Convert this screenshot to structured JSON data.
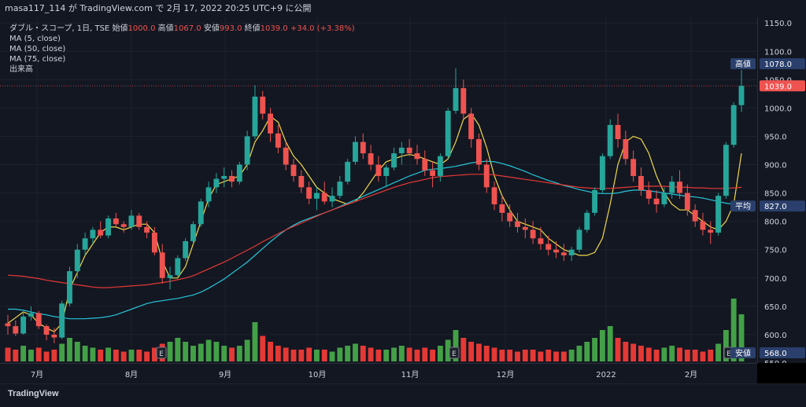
{
  "header": {
    "publish_text": "masa117_114 が TradingView.com で 2月 17, 2022 20:25 UTC+9 に公開"
  },
  "legend": {
    "symbol": "ダブル・スコープ, 1日, TSE",
    "open_label": "始値",
    "open_value": "1000.0",
    "high_label": "高値",
    "high_value": "1067.0",
    "low_label": "安値",
    "low_value": "993.0",
    "close_label": "終値",
    "close_value": "1039.0",
    "change": "+34.0 (+3.38%)",
    "indicators": [
      "MA (5, close)",
      "MA (50, close)",
      "MA (75, close)",
      "出来高"
    ]
  },
  "price_scale": {
    "ticks": [
      "1150.0",
      "1100.0",
      "1050.0",
      "1000.0",
      "950.0",
      "900.0",
      "850.0",
      "800.0",
      "750.0",
      "700.0",
      "650.0",
      "600.0",
      "550.0"
    ],
    "markers": [
      {
        "label": "高値",
        "value": "1078.0",
        "price": 1078,
        "color": "#2a3f6b"
      },
      {
        "label": "",
        "value": "1039.0",
        "price": 1039,
        "color": "#ef5350"
      },
      {
        "label": "平均",
        "value": "827.0",
        "price": 827,
        "color": "#2a3f6b"
      },
      {
        "label": "安値",
        "value": "568.0",
        "price": 568,
        "color": "#2a3f6b"
      }
    ]
  },
  "time_scale": {
    "labels": [
      "7月",
      "8月",
      "9月",
      "10月",
      "11月",
      "12月",
      "2022",
      "2月"
    ]
  },
  "footer": {
    "brand": "TradingView"
  },
  "earnings_marker": "E",
  "colors": {
    "up": "#26a69a",
    "down": "#ef5350",
    "ma5": "#f0d84a",
    "ma50": "#26c6da",
    "ma75": "#e53935",
    "vol_up": "#43a047",
    "vol_down": "#e53935"
  },
  "chart_data": {
    "type": "candlestick",
    "ylim": [
      550,
      1160
    ],
    "series": [
      {
        "name": "MA (5, close)",
        "values": [
          620,
          630,
          640,
          635,
          620,
          612,
          605,
          620,
          680,
          710,
          740,
          760,
          780,
          790,
          790,
          785,
          790,
          795,
          795,
          780,
          730,
          700,
          700,
          720,
          760,
          800,
          840,
          865,
          870,
          875,
          880,
          900,
          940,
          960,
          985,
          975,
          940,
          915,
          900,
          880,
          860,
          850,
          840,
          835,
          830,
          835,
          850,
          870,
          890,
          905,
          910,
          915,
          918,
          915,
          910,
          905,
          900,
          910,
          940,
          980,
          990,
          970,
          930,
          880,
          845,
          820,
          800,
          795,
          790,
          785,
          770,
          760,
          750,
          745,
          740,
          740,
          745,
          770,
          830,
          900,
          940,
          950,
          945,
          920,
          880,
          850,
          830,
          820,
          820,
          810,
          800,
          790,
          785,
          800,
          830,
          920
        ]
      },
      {
        "name": "MA (50, close)",
        "values": [
          645,
          645,
          643,
          640,
          637,
          635,
          632,
          630,
          628,
          628,
          628,
          629,
          630,
          632,
          635,
          640,
          645,
          650,
          655,
          658,
          660,
          662,
          664,
          667,
          670,
          675,
          682,
          690,
          698,
          708,
          718,
          728,
          740,
          752,
          764,
          775,
          785,
          793,
          800,
          805,
          810,
          815,
          820,
          826,
          832,
          838,
          844,
          850,
          856,
          862,
          868,
          874,
          880,
          885,
          890,
          892,
          893,
          895,
          897,
          900,
          903,
          905,
          906,
          905,
          902,
          898,
          893,
          888,
          882,
          877,
          872,
          868,
          863,
          860,
          856,
          853,
          850,
          849,
          849,
          850,
          853,
          855,
          855,
          854,
          852,
          850,
          848,
          846,
          844,
          843,
          841,
          838,
          835,
          832,
          830,
          828
        ]
      },
      {
        "name": "MA (75, close)",
        "values": [
          705,
          704,
          703,
          701,
          699,
          696,
          694,
          692,
          690,
          688,
          686,
          684,
          683,
          683,
          684,
          685,
          686,
          687,
          688,
          690,
          692,
          694,
          697,
          700,
          704,
          710,
          716,
          722,
          728,
          735,
          742,
          749,
          756,
          764,
          771,
          778,
          785,
          791,
          797,
          803,
          809,
          815,
          820,
          825,
          830,
          835,
          840,
          845,
          850,
          855,
          860,
          864,
          868,
          871,
          874,
          877,
          879,
          880,
          881,
          882,
          883,
          883,
          883,
          882,
          880,
          878,
          876,
          874,
          872,
          870,
          868,
          866,
          864,
          862,
          860,
          859,
          858,
          858,
          858,
          859,
          860,
          861,
          862,
          862,
          862,
          862,
          861,
          860,
          860,
          859,
          859,
          858,
          858,
          858,
          859,
          860
        ]
      }
    ],
    "candles": [
      [
        620,
        635,
        600,
        615
      ],
      [
        615,
        625,
        598,
        602
      ],
      [
        602,
        640,
        600,
        632
      ],
      [
        632,
        650,
        625,
        638
      ],
      [
        638,
        642,
        610,
        615
      ],
      [
        615,
        618,
        590,
        600
      ],
      [
        600,
        612,
        585,
        595
      ],
      [
        595,
        660,
        592,
        655
      ],
      [
        655,
        720,
        650,
        712
      ],
      [
        712,
        760,
        700,
        750
      ],
      [
        750,
        780,
        740,
        770
      ],
      [
        770,
        790,
        760,
        785
      ],
      [
        785,
        800,
        770,
        775
      ],
      [
        775,
        810,
        770,
        805
      ],
      [
        805,
        815,
        790,
        795
      ],
      [
        795,
        800,
        780,
        790
      ],
      [
        790,
        820,
        785,
        810
      ],
      [
        810,
        815,
        785,
        790
      ],
      [
        790,
        800,
        770,
        780
      ],
      [
        780,
        790,
        740,
        745
      ],
      [
        745,
        760,
        690,
        700
      ],
      [
        700,
        720,
        680,
        705
      ],
      [
        705,
        740,
        700,
        735
      ],
      [
        735,
        770,
        730,
        765
      ],
      [
        765,
        800,
        760,
        795
      ],
      [
        795,
        840,
        790,
        835
      ],
      [
        835,
        870,
        825,
        860
      ],
      [
        860,
        885,
        850,
        875
      ],
      [
        875,
        895,
        860,
        880
      ],
      [
        880,
        890,
        860,
        870
      ],
      [
        870,
        905,
        865,
        900
      ],
      [
        900,
        960,
        890,
        950
      ],
      [
        950,
        1040,
        945,
        1020
      ],
      [
        1020,
        1030,
        980,
        990
      ],
      [
        990,
        1000,
        940,
        955
      ],
      [
        955,
        970,
        920,
        930
      ],
      [
        930,
        940,
        890,
        900
      ],
      [
        900,
        910,
        870,
        880
      ],
      [
        880,
        890,
        850,
        860
      ],
      [
        860,
        870,
        830,
        840
      ],
      [
        840,
        860,
        820,
        850
      ],
      [
        850,
        870,
        830,
        835
      ],
      [
        835,
        860,
        825,
        845
      ],
      [
        845,
        880,
        840,
        870
      ],
      [
        870,
        910,
        865,
        905
      ],
      [
        905,
        950,
        900,
        940
      ],
      [
        940,
        955,
        910,
        920
      ],
      [
        920,
        935,
        890,
        900
      ],
      [
        900,
        915,
        870,
        880
      ],
      [
        880,
        900,
        860,
        895
      ],
      [
        895,
        930,
        890,
        920
      ],
      [
        920,
        940,
        900,
        930
      ],
      [
        930,
        945,
        915,
        920
      ],
      [
        920,
        935,
        900,
        910
      ],
      [
        910,
        925,
        880,
        890
      ],
      [
        890,
        905,
        860,
        880
      ],
      [
        880,
        920,
        870,
        915
      ],
      [
        915,
        1000,
        910,
        995
      ],
      [
        995,
        1070,
        990,
        1035
      ],
      [
        1035,
        1050,
        980,
        990
      ],
      [
        990,
        1000,
        930,
        945
      ],
      [
        945,
        955,
        890,
        900
      ],
      [
        900,
        910,
        850,
        860
      ],
      [
        860,
        870,
        820,
        830
      ],
      [
        830,
        845,
        800,
        815
      ],
      [
        815,
        830,
        790,
        800
      ],
      [
        800,
        815,
        780,
        790
      ],
      [
        790,
        805,
        770,
        785
      ],
      [
        785,
        800,
        760,
        770
      ],
      [
        770,
        790,
        750,
        760
      ],
      [
        760,
        775,
        740,
        750
      ],
      [
        750,
        765,
        735,
        745
      ],
      [
        745,
        760,
        730,
        740
      ],
      [
        740,
        755,
        730,
        750
      ],
      [
        750,
        790,
        745,
        785
      ],
      [
        785,
        820,
        780,
        815
      ],
      [
        815,
        860,
        810,
        855
      ],
      [
        855,
        920,
        850,
        915
      ],
      [
        915,
        980,
        910,
        970
      ],
      [
        970,
        990,
        930,
        945
      ],
      [
        945,
        960,
        900,
        910
      ],
      [
        910,
        925,
        870,
        880
      ],
      [
        880,
        895,
        845,
        855
      ],
      [
        855,
        870,
        830,
        840
      ],
      [
        840,
        855,
        815,
        830
      ],
      [
        830,
        860,
        825,
        850
      ],
      [
        850,
        880,
        840,
        870
      ],
      [
        870,
        890,
        840,
        850
      ],
      [
        850,
        865,
        810,
        820
      ],
      [
        820,
        830,
        790,
        800
      ],
      [
        800,
        815,
        775,
        785
      ],
      [
        785,
        800,
        760,
        780
      ],
      [
        780,
        850,
        775,
        845
      ],
      [
        845,
        940,
        840,
        935
      ],
      [
        935,
        1010,
        930,
        1005
      ],
      [
        1005,
        1067,
        993,
        1039
      ]
    ],
    "volume_levels": [
      0.35,
      0.3,
      0.4,
      0.3,
      0.35,
      0.25,
      0.3,
      0.45,
      0.6,
      0.5,
      0.4,
      0.35,
      0.3,
      0.35,
      0.3,
      0.25,
      0.3,
      0.3,
      0.25,
      0.35,
      0.45,
      0.5,
      0.6,
      0.5,
      0.4,
      0.45,
      0.55,
      0.5,
      0.4,
      0.35,
      0.4,
      0.55,
      1.0,
      0.65,
      0.5,
      0.4,
      0.35,
      0.3,
      0.3,
      0.35,
      0.3,
      0.3,
      0.25,
      0.35,
      0.4,
      0.45,
      0.4,
      0.35,
      0.3,
      0.3,
      0.35,
      0.4,
      0.35,
      0.3,
      0.35,
      0.3,
      0.4,
      0.55,
      0.8,
      0.6,
      0.5,
      0.45,
      0.4,
      0.35,
      0.3,
      0.3,
      0.25,
      0.3,
      0.3,
      0.25,
      0.3,
      0.25,
      0.25,
      0.3,
      0.4,
      0.5,
      0.6,
      0.8,
      0.9,
      0.6,
      0.5,
      0.45,
      0.4,
      0.35,
      0.3,
      0.35,
      0.4,
      0.35,
      0.3,
      0.3,
      0.25,
      0.3,
      0.45,
      0.8,
      1.6,
      1.2
    ],
    "earnings_index": [
      18,
      52,
      85
    ]
  }
}
